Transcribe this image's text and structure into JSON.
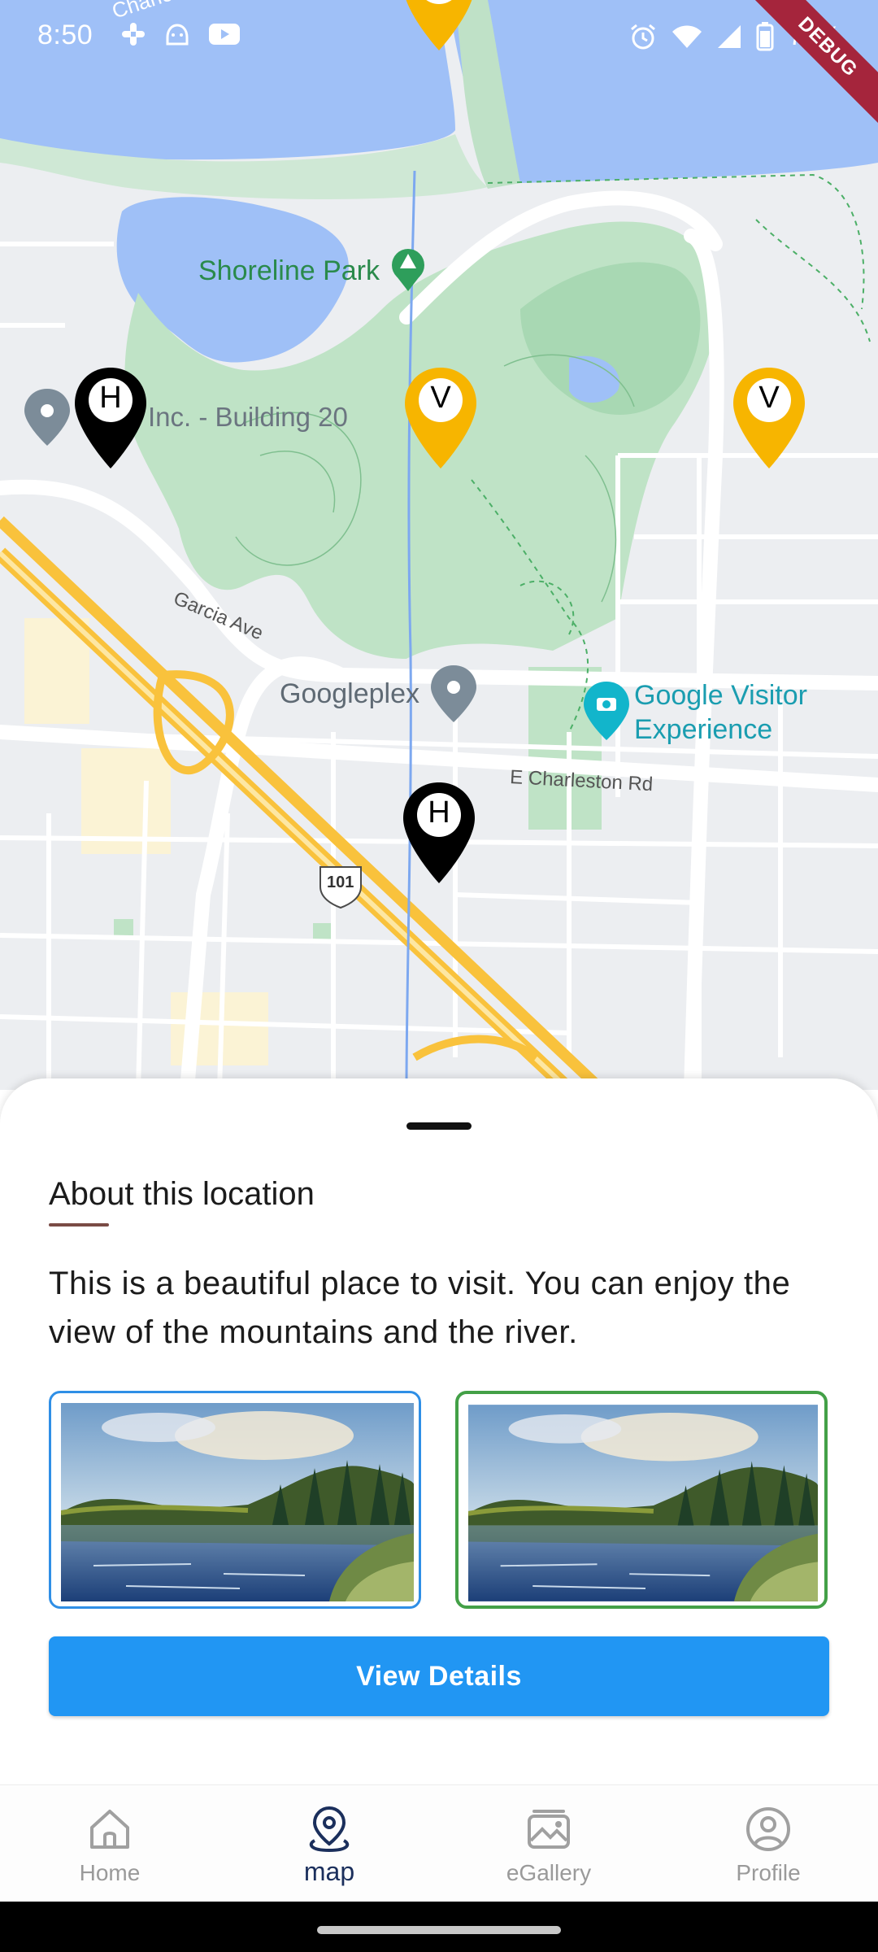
{
  "status_bar": {
    "time": "8:50",
    "battery": "78%",
    "left_icons": [
      "slack-icon",
      "android-icon",
      "youtube-icon"
    ],
    "right_icons": [
      "alarm-icon",
      "wifi-icon",
      "signal-icon",
      "battery-icon"
    ]
  },
  "debug_banner": "DEBUG",
  "map": {
    "labels": {
      "shoreline_park": "Shoreline Park",
      "building_20": "Inc. - Building 20",
      "garcia_ave": "Garcia Ave",
      "googleplex": "Googleplex",
      "visitor_line1": "Google Visitor",
      "visitor_line2": "Experience",
      "charleston": "E Charleston Rd",
      "highway": "101",
      "charleston_top": "Charles"
    },
    "pins": [
      {
        "type": "hotel",
        "letter": "H",
        "color": "#000000"
      },
      {
        "type": "visit",
        "letter": "V",
        "color": "#f7b500"
      },
      {
        "type": "visit",
        "letter": "V",
        "color": "#f7b500"
      },
      {
        "type": "hotel",
        "letter": "H",
        "color": "#000000"
      },
      {
        "type": "visit",
        "letter": "",
        "color": "#f7b500"
      }
    ]
  },
  "sheet": {
    "title": "About this location",
    "description": "This is a beautiful place to visit. You can enjoy the view of the mountains and the river.",
    "button_label": "View Details"
  },
  "colors": {
    "accent": "#2196f3",
    "hotel_pin": "#000000",
    "visit_pin": "#f7b500",
    "active_nav": "#1b2f5c",
    "thumb_border_1": "#2f8fe6",
    "thumb_border_2": "#43a047"
  },
  "nav": {
    "items": [
      {
        "label": "Home",
        "icon": "home-icon"
      },
      {
        "label": "map",
        "icon": "map-pin-icon"
      },
      {
        "label": "eGallery",
        "icon": "gallery-icon"
      },
      {
        "label": "Profile",
        "icon": "profile-icon"
      }
    ],
    "active": "map"
  }
}
